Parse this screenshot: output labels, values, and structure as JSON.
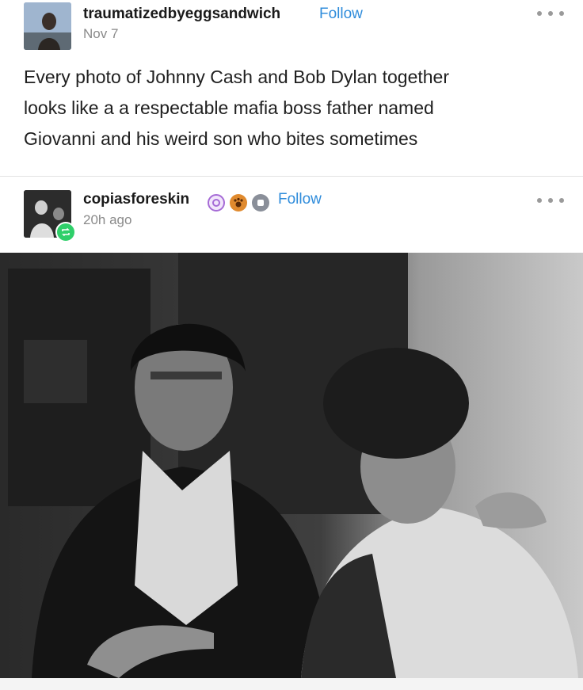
{
  "posts": [
    {
      "username": "traumatizedbyeggsandwich",
      "follow_label": "Follow",
      "timestamp": "Nov 7",
      "text": "Every photo of Johnny Cash and Bob Dylan together\nlooks like a a respectable mafia boss father named\nGiovanni and his weird son who bites sometimes",
      "avatar_icon": "avatar-image",
      "menu_icon": "more-options-icon"
    },
    {
      "username": "copiasforeskin",
      "follow_label": "Follow",
      "timestamp": "20h ago",
      "badges": [
        "purple-badge-icon",
        "orange-paw-badge-icon",
        "grey-badge-icon"
      ],
      "reblog_icon": "reblog-icon",
      "menu_icon": "more-options-icon"
    }
  ],
  "colors": {
    "follow": "#2f8cdb",
    "badge_purple": "#a66bd6",
    "badge_orange": "#e08a2e",
    "badge_grey": "#8a8f99",
    "reblog_green": "#2fcf6a"
  }
}
